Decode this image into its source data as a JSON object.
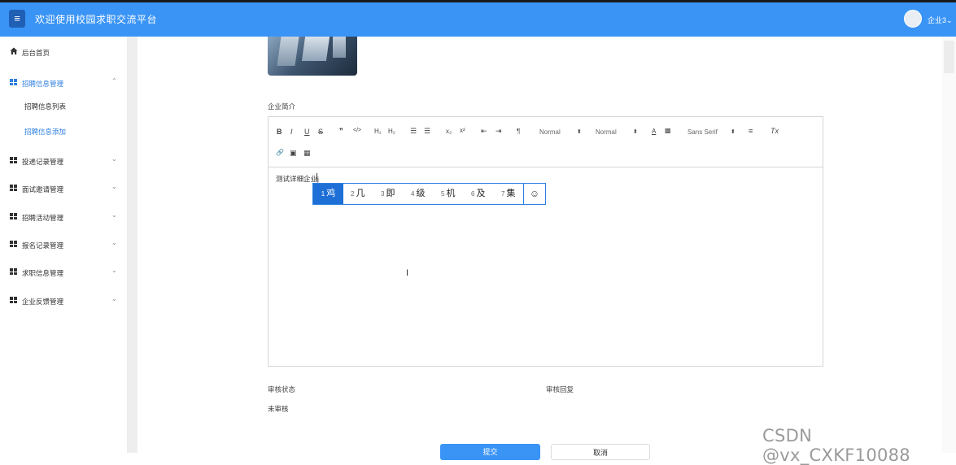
{
  "header": {
    "title": "欢迎使用校园求职交流平台",
    "user": "企业3",
    "user_chevron": "⌄",
    "menu_icon": "≡"
  },
  "sidebar": {
    "home": "后台首页",
    "menus": [
      {
        "label": "招聘信息管理",
        "expanded": true
      },
      {
        "label": "投递记录管理"
      },
      {
        "label": "面试邀请管理"
      },
      {
        "label": "招聘活动管理"
      },
      {
        "label": "报名记录管理"
      },
      {
        "label": "求职信息管理"
      },
      {
        "label": "企业反馈管理"
      }
    ],
    "sub_items": [
      "招聘信息列表",
      "招聘信息添加"
    ],
    "chev_open": "⌃",
    "chev_closed": "⌄"
  },
  "form": {
    "intro_label": "企业简介",
    "editor_text": "测试详细企业j",
    "audit_status_label": "审核状态",
    "audit_reply_label": "审核回复",
    "audit_status_value": "未审核",
    "submit_label": "提交",
    "cancel_label": "取消"
  },
  "toolbar": {
    "bold": "B",
    "italic": "I",
    "underline": "U",
    "strike": "S",
    "quote": "❞",
    "code": "</>",
    "h1": "H₁",
    "h2": "H₂",
    "ordered_list": "☰",
    "bullet_list": "☰",
    "sub": "x₂",
    "sup": "x²",
    "indent_less": "⇤",
    "indent_more": "⇥",
    "direction": "¶",
    "size_select": "Normal",
    "header_select": "Normal",
    "color": "A",
    "background": "▩",
    "font_select": "Sans Serif",
    "align": "≡",
    "clean": "Tx",
    "link": "🔗",
    "image": "▣",
    "video": "▦",
    "select_arrow": "⬍"
  },
  "ime": {
    "candidates": [
      {
        "n": "1",
        "c": "鸡"
      },
      {
        "n": "2",
        "c": "几"
      },
      {
        "n": "3",
        "c": "即"
      },
      {
        "n": "4",
        "c": "级"
      },
      {
        "n": "5",
        "c": "机"
      },
      {
        "n": "6",
        "c": "及"
      },
      {
        "n": "7",
        "c": "集"
      }
    ],
    "emoji": "☺",
    "selected_index": 0
  },
  "cursor_glyph": "I",
  "watermark": "CSDN @vx_CXKF10088",
  "colors": {
    "accent": "#3a94f6",
    "active_menu": "#2d7fe0",
    "ime_selected": "#1e6fd6"
  }
}
